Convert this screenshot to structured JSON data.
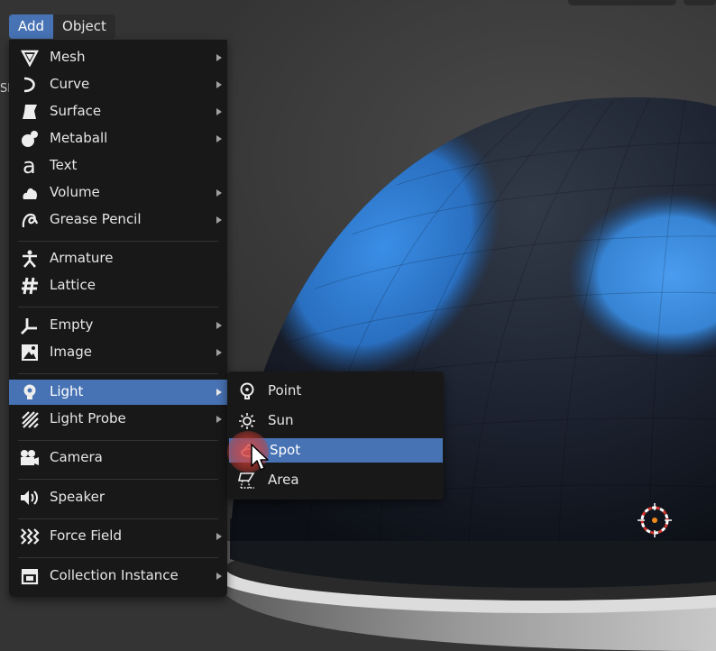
{
  "header": {
    "menus": [
      {
        "label": "Add",
        "active": true
      },
      {
        "label": "Object",
        "active": false
      }
    ]
  },
  "viewport": {
    "partial_text": "Sh"
  },
  "add_menu": {
    "items": [
      {
        "label": "Mesh",
        "icon": "mesh-icon",
        "submenu": true
      },
      {
        "label": "Curve",
        "icon": "curve-icon",
        "submenu": true
      },
      {
        "label": "Surface",
        "icon": "surface-icon",
        "submenu": true
      },
      {
        "label": "Metaball",
        "icon": "metaball-icon",
        "submenu": true
      },
      {
        "label": "Text",
        "icon": "text-icon",
        "submenu": false
      },
      {
        "label": "Volume",
        "icon": "volume-icon",
        "submenu": true
      },
      {
        "label": "Grease Pencil",
        "icon": "grease-pencil-icon",
        "submenu": true
      },
      {
        "label": "Armature",
        "icon": "armature-icon",
        "submenu": false
      },
      {
        "label": "Lattice",
        "icon": "lattice-icon",
        "submenu": false
      },
      {
        "label": "Empty",
        "icon": "empty-icon",
        "submenu": true
      },
      {
        "label": "Image",
        "icon": "image-icon",
        "submenu": true
      },
      {
        "label": "Light",
        "icon": "light-icon",
        "submenu": true,
        "highlighted": true
      },
      {
        "label": "Light Probe",
        "icon": "light-probe-icon",
        "submenu": true
      },
      {
        "label": "Camera",
        "icon": "camera-icon",
        "submenu": false
      },
      {
        "label": "Speaker",
        "icon": "speaker-icon",
        "submenu": false
      },
      {
        "label": "Force Field",
        "icon": "force-field-icon",
        "submenu": true
      },
      {
        "label": "Collection Instance",
        "icon": "collection-instance-icon",
        "submenu": true
      }
    ]
  },
  "light_menu": {
    "items": [
      {
        "label": "Point",
        "icon": "point-light-icon"
      },
      {
        "label": "Sun",
        "icon": "sun-light-icon"
      },
      {
        "label": "Spot",
        "icon": "spot-light-icon",
        "highlighted": true
      },
      {
        "label": "Area",
        "icon": "area-light-icon"
      }
    ]
  },
  "colors": {
    "accent": "#4772b3",
    "menu_bg": "#181818",
    "text": "#e6e6e6"
  }
}
